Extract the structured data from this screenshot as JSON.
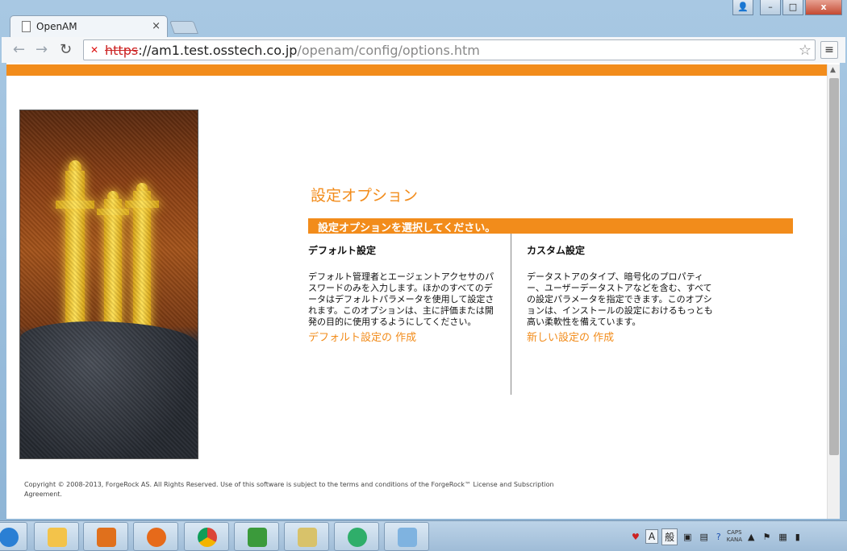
{
  "browser": {
    "tab_title": "OpenAM",
    "tab_close": "×",
    "url_scheme": "https",
    "url_host": "://am1.test.osstech.co.jp",
    "url_path": "/openam/config/options.htm",
    "back_glyph": "←",
    "forward_glyph": "→",
    "reload_glyph": "↻",
    "star_glyph": "☆",
    "menu_glyph": "≡",
    "lock_glyph": "✕"
  },
  "window": {
    "user_glyph": "👤",
    "minimize_glyph": "–",
    "maximize_glyph": "□",
    "close_glyph": "x"
  },
  "page": {
    "heading": "設定オプション",
    "select_prompt": "設定オプションを選択してください。",
    "default": {
      "title": "デフォルト設定",
      "description": "デフォルト管理者とエージェントアクセサのパスワードのみを入力します。ほかのすべてのデータはデフォルトパラメータを使用して設定されます。このオプションは、主に評価または開発の目的に使用するようにしてください。",
      "link": "デフォルト設定の 作成"
    },
    "custom": {
      "title": "カスタム設定",
      "description": "データストアのタイプ、暗号化のプロパティー、ユーザーデータストアなどを含む、すべての設定パラメータを指定できます。このオプションは、インストールの設定におけるもっとも高い柔軟性を備えています。",
      "link": "新しい設定の 作成"
    },
    "copyright": "Copyright © 2008-2013, ForgeRock AS. All Rights Reserved. Use of this software is subject to the terms and conditions of the ForgeRock™ License and Subscription Agreement."
  },
  "taskbar": {
    "apps": [
      "internet-explorer",
      "file-explorer",
      "media-player",
      "firefox",
      "chrome",
      "spreadsheet",
      "terminal",
      "atom-app",
      "notepad"
    ],
    "tray": {
      "ime_a": "A",
      "ime_mode": "般",
      "caps": "CAPS",
      "kana": "KANA"
    }
  },
  "colors": {
    "accent": "#f28c1b"
  }
}
